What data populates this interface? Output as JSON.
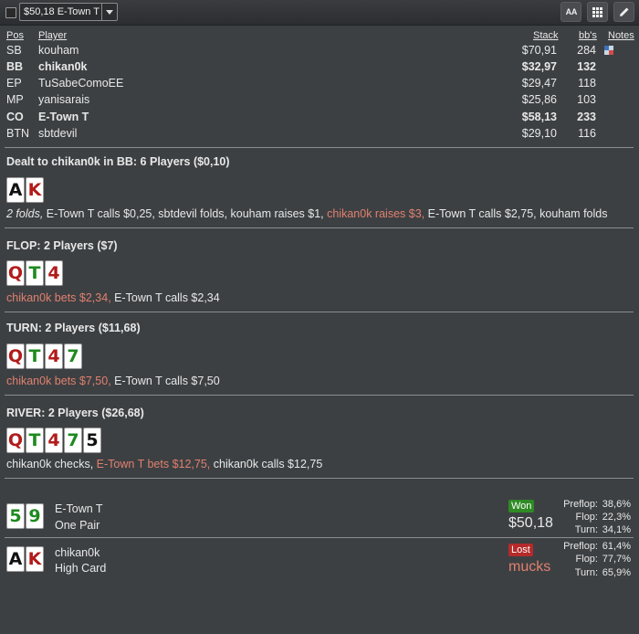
{
  "toolbar": {
    "hand_select_value": "$50,18 E-Town T",
    "font_button_label": "A A",
    "grid_button_icon": "grid-icon",
    "edit_button_icon": "pencil-icon"
  },
  "table_headers": {
    "pos": "Pos",
    "player": "Player",
    "stack": "Stack",
    "bbs": "bb's",
    "notes": "Notes"
  },
  "players": [
    {
      "pos": "SB",
      "name": "kouham",
      "stack": "$70,91",
      "bbs": "284",
      "bold": false,
      "has_note": true
    },
    {
      "pos": "BB",
      "name": "chikan0k",
      "stack": "$32,97",
      "bbs": "132",
      "bold": true,
      "has_note": false
    },
    {
      "pos": "EP",
      "name": "TuSabeComoEE",
      "stack": "$29,47",
      "bbs": "118",
      "bold": false,
      "has_note": false
    },
    {
      "pos": "MP",
      "name": "yanisarais",
      "stack": "$25,86",
      "bbs": "103",
      "bold": false,
      "has_note": false
    },
    {
      "pos": "CO",
      "name": "E-Town T",
      "stack": "$58,13",
      "bbs": "233",
      "bold": true,
      "has_note": false
    },
    {
      "pos": "BTN",
      "name": "sbtdevil",
      "stack": "$29,10",
      "bbs": "116",
      "bold": false,
      "has_note": false
    }
  ],
  "preflop": {
    "title": "Dealt to chikan0k in BB: 6 Players ($0,10)",
    "cards": [
      {
        "rank": "A",
        "color": "black"
      },
      {
        "rank": "K",
        "color": "red"
      }
    ],
    "action": {
      "folds": "2 folds,",
      "part1": " E-Town T calls $0,25, sbtdevil folds, kouham raises $1,",
      "red": " chikan0k raises $3,",
      "part2": " E-Town T calls $2,75, kouham folds"
    }
  },
  "flop": {
    "title": "FLOP: 2 Players ($7)",
    "cards": [
      {
        "rank": "Q",
        "color": "red"
      },
      {
        "rank": "T",
        "color": "green"
      },
      {
        "rank": "4",
        "color": "red"
      }
    ],
    "action": {
      "red": "chikan0k bets $2,34,",
      "rest": " E-Town T calls $2,34"
    }
  },
  "turn": {
    "title": "TURN: 2 Players ($11,68)",
    "cards": [
      {
        "rank": "Q",
        "color": "red"
      },
      {
        "rank": "T",
        "color": "green"
      },
      {
        "rank": "4",
        "color": "red"
      },
      {
        "rank": "7",
        "color": "green"
      }
    ],
    "action": {
      "red": "chikan0k bets $7,50,",
      "rest": " E-Town T calls $7,50"
    }
  },
  "river": {
    "title": "RIVER: 2 Players ($26,68)",
    "cards": [
      {
        "rank": "Q",
        "color": "red"
      },
      {
        "rank": "T",
        "color": "green"
      },
      {
        "rank": "4",
        "color": "red"
      },
      {
        "rank": "7",
        "color": "green"
      },
      {
        "rank": "5",
        "color": "black"
      }
    ],
    "action": {
      "part1": "chikan0k checks,",
      "red": " E-Town T bets $12,75,",
      "part2": " chikan0k calls $12,75"
    }
  },
  "results": [
    {
      "name": "E-Town T",
      "hand": "One Pair",
      "badge": "Won",
      "amount": "$50,18",
      "cards": [
        {
          "rank": "5",
          "color": "green"
        },
        {
          "rank": "9",
          "color": "green"
        }
      ],
      "equity": [
        {
          "label": "Preflop:",
          "value": "38,6%"
        },
        {
          "label": "Flop:",
          "value": "22,3%"
        },
        {
          "label": "Turn:",
          "value": "34,1%"
        }
      ]
    },
    {
      "name": "chikan0k",
      "hand": "High Card",
      "badge": "Lost",
      "amount": "mucks",
      "cards": [
        {
          "rank": "A",
          "color": "black"
        },
        {
          "rank": "K",
          "color": "red"
        }
      ],
      "equity": [
        {
          "label": "Preflop:",
          "value": "61,4%"
        },
        {
          "label": "Flop:",
          "value": "77,7%"
        },
        {
          "label": "Turn:",
          "value": "65,9%"
        }
      ]
    }
  ],
  "colors": {
    "background": "#3d4043",
    "action_red": "#e0806e",
    "card_red": "#b21b1b",
    "card_green": "#1e8a1e",
    "won": "#2f8a25",
    "lost": "#b52a2a"
  }
}
